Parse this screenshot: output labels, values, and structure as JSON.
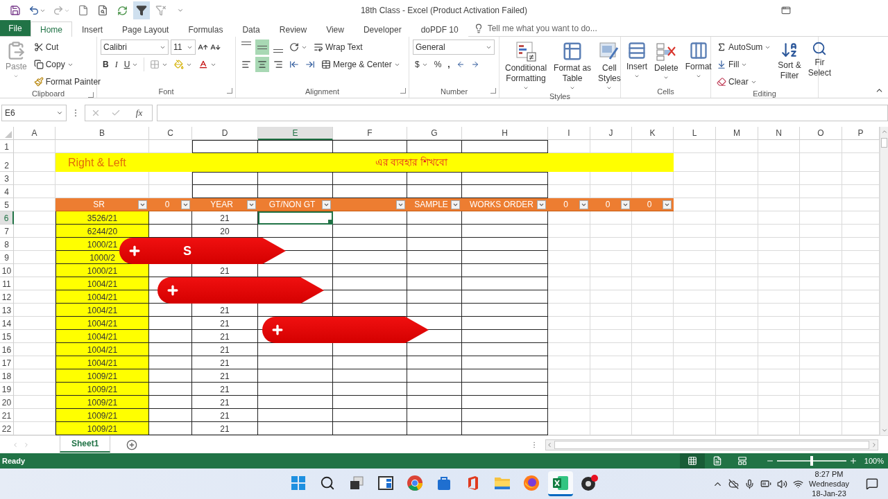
{
  "title_bar": {
    "title": "18th Class - Excel (Product Activation Failed)"
  },
  "quick_access": [
    {
      "kind": "save",
      "selected": false
    },
    {
      "kind": "undo",
      "selected": false
    },
    {
      "kind": "redo",
      "selected": false
    },
    {
      "kind": "new",
      "selected": false
    },
    {
      "kind": "preview",
      "selected": false
    },
    {
      "kind": "refresh",
      "selected": false
    },
    {
      "kind": "filter",
      "selected": true
    },
    {
      "kind": "clear_filter",
      "selected": false
    },
    {
      "kind": "customize",
      "selected": false
    }
  ],
  "tabs": [
    {
      "label": "File",
      "kind": "file",
      "selected": false
    },
    {
      "label": "Home",
      "kind": "tab",
      "selected": true
    },
    {
      "label": "Insert",
      "kind": "tab",
      "selected": false
    },
    {
      "label": "Page Layout",
      "kind": "tab",
      "selected": false
    },
    {
      "label": "Formulas",
      "kind": "tab",
      "selected": false
    },
    {
      "label": "Data",
      "kind": "tab",
      "selected": false
    },
    {
      "label": "Review",
      "kind": "tab",
      "selected": false
    },
    {
      "label": "View",
      "kind": "tab",
      "selected": false
    },
    {
      "label": "Developer",
      "kind": "tab",
      "selected": false
    },
    {
      "label": "doPDF 10",
      "kind": "tab",
      "selected": false
    }
  ],
  "tell_me": {
    "placeholder": "Tell me what you want to do..."
  },
  "ribbon": {
    "clipboard": {
      "label": "Clipboard",
      "paste": "Paste",
      "cut": "Cut",
      "copy": "Copy",
      "format_painter": "Format Painter"
    },
    "font": {
      "label": "Font",
      "family": "Calibri",
      "size": "11",
      "bold": "B",
      "italic": "I",
      "underline": "U"
    },
    "alignment": {
      "label": "Alignment",
      "wrap_text": "Wrap Text",
      "merge_center": "Merge & Center",
      "vertical": [
        {
          "selected": false
        },
        {
          "selected": true
        },
        {
          "selected": false
        }
      ],
      "horizontal": [
        {
          "selected": false
        },
        {
          "selected": true
        },
        {
          "selected": false
        }
      ]
    },
    "number": {
      "label": "Number",
      "format": "General",
      "currency": "$",
      "percent": "%",
      "comma": ","
    },
    "styles": {
      "label": "Styles",
      "buttons": [
        {
          "kind": "conditional",
          "lines": [
            "Conditional",
            "Formatting"
          ]
        },
        {
          "kind": "table",
          "lines": [
            "Format as",
            "Table"
          ]
        },
        {
          "kind": "cell_styles",
          "lines": [
            "Cell",
            "Styles"
          ]
        }
      ]
    },
    "cells": {
      "label": "Cells",
      "buttons": [
        {
          "kind": "insert",
          "label": "Insert"
        },
        {
          "kind": "delete",
          "label": "Delete"
        },
        {
          "kind": "format",
          "label": "Format"
        }
      ]
    },
    "editing": {
      "label": "Editing",
      "autosum": "AutoSum",
      "fill": "Fill",
      "clear": "Clear",
      "sort_filter": [
        "Sort &",
        "Filter"
      ],
      "find_select": [
        "Fir",
        "Select"
      ]
    }
  },
  "formula_bar": {
    "name_box": "E6",
    "fx": "fx"
  },
  "sheet": {
    "columns": [
      {
        "label": "A",
        "selected": false
      },
      {
        "label": "B",
        "selected": false
      },
      {
        "label": "C",
        "selected": false
      },
      {
        "label": "D",
        "selected": false
      },
      {
        "label": "E",
        "selected": true
      },
      {
        "label": "F",
        "selected": false
      },
      {
        "label": "G",
        "selected": false
      },
      {
        "label": "H",
        "selected": false
      },
      {
        "label": "I",
        "selected": false
      },
      {
        "label": "J",
        "selected": false
      },
      {
        "label": "K",
        "selected": false
      },
      {
        "label": "L",
        "selected": false
      },
      {
        "label": "M",
        "selected": false
      },
      {
        "label": "N",
        "selected": false
      },
      {
        "label": "O",
        "selected": false
      },
      {
        "label": "P",
        "selected": false
      }
    ],
    "rows": [
      {
        "number": "1",
        "kind": "frame",
        "selected": false
      },
      {
        "number": "2",
        "kind": "banner",
        "selected": false,
        "title": "Right & Left",
        "subtitle": "এর ব্যবহার শিখবো"
      },
      {
        "number": "3",
        "kind": "frame",
        "selected": false
      },
      {
        "number": "4",
        "kind": "frame",
        "selected": false
      },
      {
        "number": "5",
        "kind": "header",
        "selected": false,
        "cells": {
          "B": {
            "text": "SR",
            "filter": true
          },
          "C": {
            "text": "0",
            "filter": true
          },
          "D": {
            "text": "YEAR",
            "filter": true
          },
          "E": {
            "text": "GT/NON GT",
            "filter": true
          },
          "F": {
            "filter": true
          },
          "G": {
            "text": "SAMPLE",
            "filter": true
          },
          "H": {
            "text": "WORKS ORDER",
            "filter": true
          },
          "I": {
            "text": "0",
            "filter": true
          },
          "J": {
            "text": "0",
            "filter": true
          },
          "K": {
            "text": "0",
            "filter": true
          }
        }
      },
      {
        "number": "6",
        "kind": "data",
        "selected": true,
        "cells": {
          "B": "3526/21",
          "D": "21",
          "E": {
            "selected": true
          }
        }
      },
      {
        "number": "7",
        "kind": "data",
        "selected": false,
        "cells": {
          "B": "6244/20",
          "D": "20"
        }
      },
      {
        "number": "8",
        "kind": "data",
        "selected": false,
        "cells": {
          "B": "1000/21"
        }
      },
      {
        "number": "9",
        "kind": "data",
        "selected": false,
        "cells": {
          "B": "1000/2"
        }
      },
      {
        "number": "10",
        "kind": "data",
        "selected": false,
        "cells": {
          "B": "1000/21",
          "D": "21"
        }
      },
      {
        "number": "11",
        "kind": "data",
        "selected": false,
        "cells": {
          "B": "1004/21"
        }
      },
      {
        "number": "12",
        "kind": "data",
        "selected": false,
        "cells": {
          "B": "1004/21"
        }
      },
      {
        "number": "13",
        "kind": "data",
        "selected": false,
        "cells": {
          "B": "1004/21",
          "D": "21"
        }
      },
      {
        "number": "14",
        "kind": "data",
        "selected": false,
        "cells": {
          "B": "1004/21",
          "D": "21"
        }
      },
      {
        "number": "15",
        "kind": "data",
        "selected": false,
        "cells": {
          "B": "1004/21",
          "D": "21"
        }
      },
      {
        "number": "16",
        "kind": "data",
        "selected": false,
        "cells": {
          "B": "1004/21",
          "D": "21"
        }
      },
      {
        "number": "17",
        "kind": "data",
        "selected": false,
        "cells": {
          "B": "1004/21",
          "D": "21"
        }
      },
      {
        "number": "18",
        "kind": "data",
        "selected": false,
        "cells": {
          "B": "1009/21",
          "D": "21"
        }
      },
      {
        "number": "19",
        "kind": "data",
        "selected": false,
        "cells": {
          "B": "1009/21",
          "D": "21"
        }
      },
      {
        "number": "20",
        "kind": "data",
        "selected": false,
        "cells": {
          "B": "1009/21",
          "D": "21"
        }
      },
      {
        "number": "21",
        "kind": "data",
        "selected": false,
        "cells": {
          "B": "1009/21",
          "D": "21"
        }
      },
      {
        "number": "22",
        "kind": "data",
        "selected": false,
        "cells": {
          "B": "1009/21",
          "D": "21"
        }
      }
    ],
    "overlay_ribbons": [
      {
        "kind": "ribbon",
        "label": "S"
      },
      {
        "kind": "ribbon"
      },
      {
        "kind": "ribbon"
      }
    ]
  },
  "sheet_tabs": [
    {
      "label": "Sheet1",
      "selected": true
    }
  ],
  "status_bar": {
    "status": "Ready",
    "views": [
      {
        "kind": "normal",
        "selected": true
      },
      {
        "kind": "page_layout",
        "selected": false
      },
      {
        "kind": "page_break",
        "selected": false
      }
    ],
    "zoom_slider": {
      "level": 0.5
    },
    "zoom": "100%"
  },
  "taskbar": {
    "apps": [
      {
        "kind": "start",
        "selected": false
      },
      {
        "kind": "search",
        "selected": false
      },
      {
        "kind": "task_view",
        "selected": false
      },
      {
        "kind": "widgets",
        "selected": false
      },
      {
        "kind": "browser",
        "selected": false
      },
      {
        "kind": "store",
        "selected": false
      },
      {
        "kind": "office",
        "selected": false
      },
      {
        "kind": "folder",
        "selected": false
      },
      {
        "kind": "firefox",
        "selected": false
      },
      {
        "kind": "excel",
        "selected": true
      },
      {
        "kind": "recorder",
        "selected": false
      }
    ],
    "time": "8:27 PM",
    "day": "Wednesday",
    "date": "18-Jan-23"
  }
}
